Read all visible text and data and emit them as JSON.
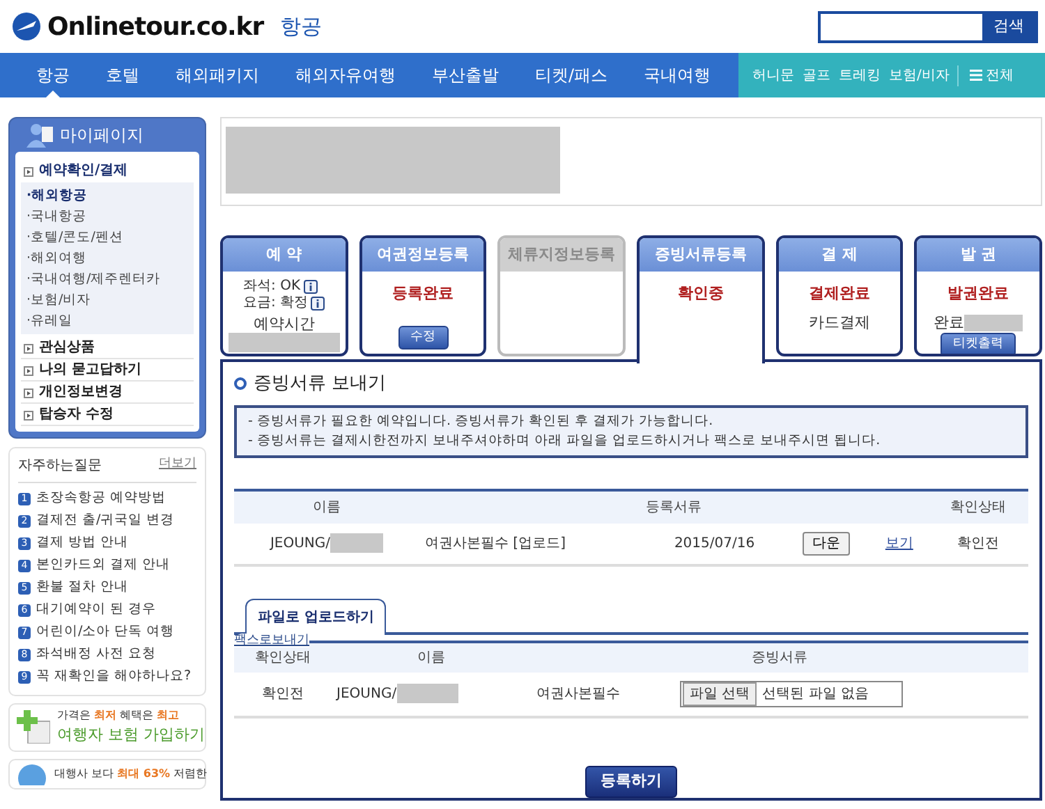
{
  "header": {
    "logo": "Onlinetour.co.kr",
    "section": "항공",
    "search_button": "검색"
  },
  "nav": {
    "items": [
      {
        "label": "항공",
        "selected": true
      },
      {
        "label": "호텔",
        "selected": false
      },
      {
        "label": "해외패키지",
        "selected": false
      },
      {
        "label": "해외자유여행",
        "selected": false
      },
      {
        "label": "부산출발",
        "selected": false
      },
      {
        "label": "티켓/패스",
        "selected": false
      },
      {
        "label": "국내여행",
        "selected": false
      }
    ],
    "secondary": [
      "허니문",
      "골프",
      "트레킹",
      "보험/비자"
    ],
    "all_menu": "전체"
  },
  "sidebar": {
    "title": "마이페이지",
    "menu": [
      {
        "label": "예약확인/결제",
        "expanded": true,
        "children": [
          {
            "label": "·해외항공",
            "selected": true
          },
          {
            "label": "·국내항공",
            "selected": false
          },
          {
            "label": "·호텔/콘도/펜션",
            "selected": false
          },
          {
            "label": "·해외여행",
            "selected": false
          },
          {
            "label": "·국내여행/제주렌터카",
            "selected": false
          },
          {
            "label": "·보험/비자",
            "selected": false
          },
          {
            "label": "·유레일",
            "selected": false
          }
        ]
      },
      {
        "label": "관심상품",
        "expanded": false
      },
      {
        "label": "나의 묻고답하기",
        "expanded": false
      },
      {
        "label": "개인정보변경",
        "expanded": false
      },
      {
        "label": "탑승자 수정",
        "expanded": false
      }
    ]
  },
  "faq": {
    "title": "자주하는질문",
    "more": "더보기",
    "items": [
      {
        "number": "1",
        "text": "초장속항공 예약방법"
      },
      {
        "number": "2",
        "text": "결제전 출/귀국일 변경"
      },
      {
        "number": "3",
        "text": "결제 방법 안내"
      },
      {
        "number": "4",
        "text": "본인카드외 결제 안내"
      },
      {
        "number": "5",
        "text": "환불 절차 안내"
      },
      {
        "number": "6",
        "text": "대기예약이 된 경우"
      },
      {
        "number": "7",
        "text": "어린이/소아 단독 여행"
      },
      {
        "number": "8",
        "text": "좌석배정 사전 요청"
      },
      {
        "number": "9",
        "text": "꼭 재확인을 해야하나요?"
      }
    ]
  },
  "banners": [
    {
      "kind": "insurance",
      "line1": "가격은 **최저** 혜택은 **최고**",
      "line2": "여행자 보험 가입하기"
    },
    {
      "kind": "visa",
      "line1": "대행사 보다 **최대 63%** 저렴한"
    }
  ],
  "steps": [
    {
      "title": "예 약",
      "selected": false,
      "disabled": false,
      "info_lines": [
        "좌석: OK",
        "요금: 확정"
      ],
      "note": "예약시간"
    },
    {
      "title": "여권정보등록",
      "selected": false,
      "disabled": false,
      "status": "등록완료",
      "button": "수정"
    },
    {
      "title": "체류지정보등록",
      "selected": false,
      "disabled": true
    },
    {
      "title": "증빙서류등록",
      "selected": true,
      "disabled": false,
      "status": "확인중"
    },
    {
      "title": "결 제",
      "selected": false,
      "disabled": false,
      "status": "결제완료",
      "note": "카드결제"
    },
    {
      "title": "발 권",
      "selected": false,
      "disabled": false,
      "status": "발권완료",
      "note": "완료",
      "button": "티켓출력"
    }
  ],
  "panel": {
    "title": "증빙서류 보내기",
    "notices": [
      "- 증빙서류가 필요한 예약입니다. 증빙서류가 확인된 후 결제가 가능합니다.",
      "- 증빙서류는 결제시한전까지 보내주셔야하며 아래 파일을 업로드하시거나 팩스로 보내주시면 됩니다."
    ],
    "documents_table": {
      "columns": [
        "이름",
        "등록서류",
        "확인상태"
      ],
      "rows": [
        {
          "name": "JEOUNG/",
          "document": "여권사본필수 [업로드]",
          "date": "2015/07/16",
          "download_button": "다운",
          "view_link": "보기",
          "status": "확인전"
        }
      ]
    },
    "tabs": [
      {
        "label": "파일로 업로드하기",
        "selected": true
      },
      {
        "label": "팩스로보내기",
        "selected": false
      }
    ],
    "upload_table": {
      "columns": [
        "확인상태",
        "이름",
        "증빙서류"
      ],
      "rows": [
        {
          "status": "확인전",
          "name": "JEOUNG/",
          "document": "여권사본필수",
          "file_button": "파일 선택",
          "file_status": "선택된 파일 없음"
        }
      ]
    },
    "submit_button": "등록하기"
  }
}
